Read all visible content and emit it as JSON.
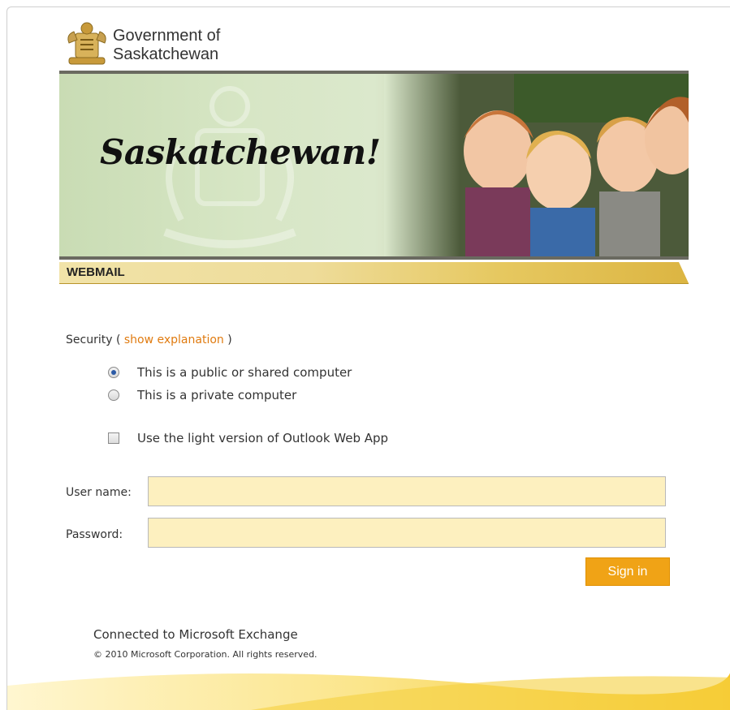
{
  "header": {
    "logo_line1": "Government of",
    "logo_line2": "Saskatchewan"
  },
  "banner": {
    "title": "Saskatchewan!"
  },
  "section_bar": {
    "label": "WEBMAIL"
  },
  "security": {
    "label": "Security (",
    "link": "show explanation",
    "close": ")",
    "options": [
      {
        "label": "This is a public or shared computer",
        "selected": true
      },
      {
        "label": "This is a private computer",
        "selected": false
      }
    ],
    "light_version": {
      "label": "Use the light version of Outlook Web App",
      "checked": false
    }
  },
  "form": {
    "username_label": "User name:",
    "username_value": "",
    "password_label": "Password:",
    "password_value": "",
    "signin_label": "Sign in"
  },
  "footer": {
    "connected": "Connected to Microsoft Exchange",
    "copyright": "© 2010 Microsoft Corporation. All rights reserved."
  },
  "colors": {
    "accent": "#f0a316",
    "input_bg": "#fdf0bf",
    "link": "#e07b10"
  }
}
